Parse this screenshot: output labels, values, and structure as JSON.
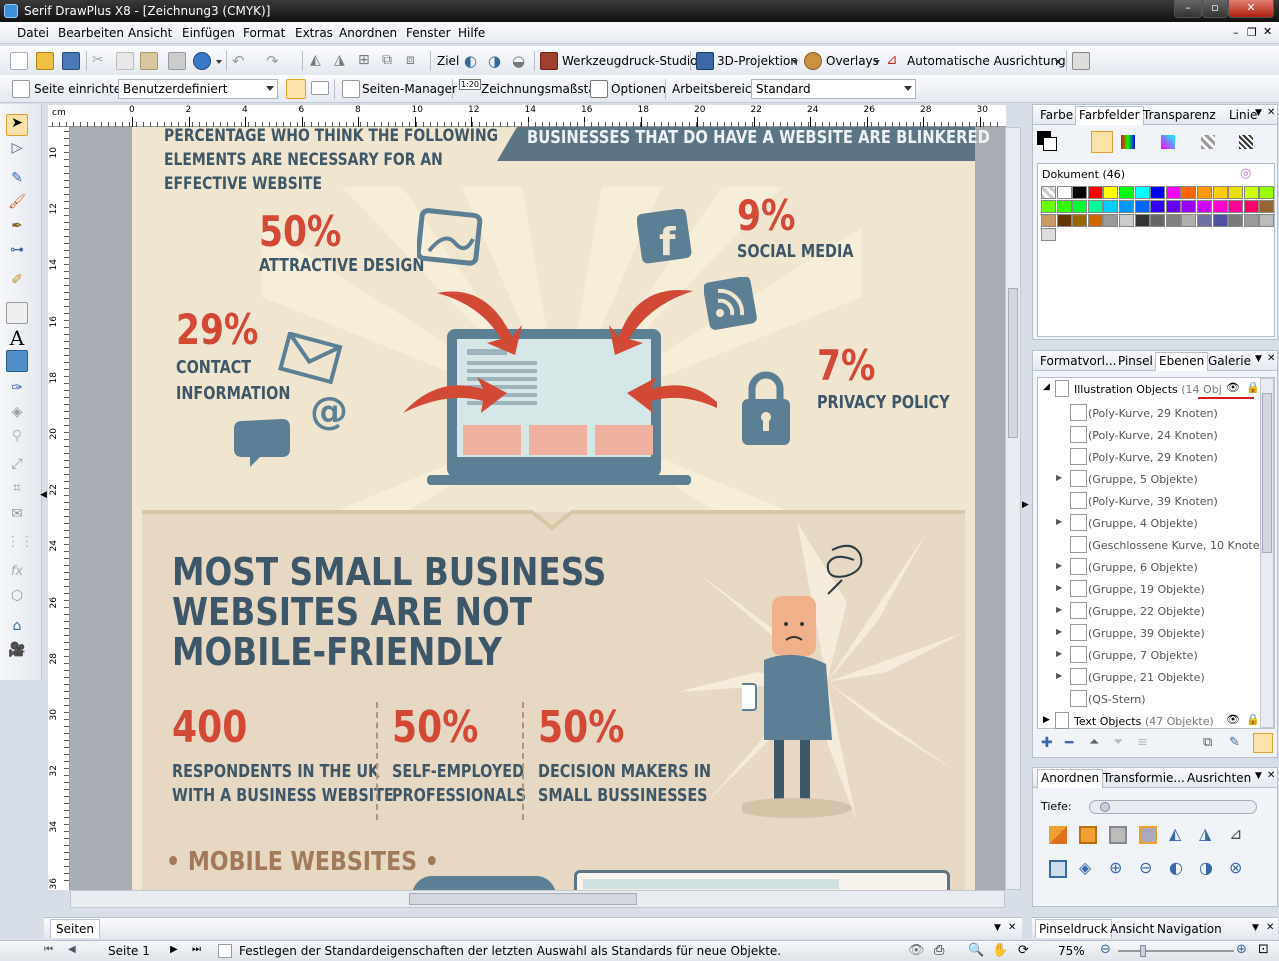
{
  "window": {
    "title": "Serif DrawPlus X8 - [Zeichnung3 (CMYK)]"
  },
  "menu": [
    "Datei",
    "Bearbeiten",
    "Ansicht",
    "Einfügen",
    "Format",
    "Extras",
    "Anordnen",
    "Fenster",
    "Hilfe"
  ],
  "toolbar1": {
    "target_label": "Ziel",
    "print_studio": "Werkzeugdruck-Studio",
    "projection": "3D-Projektion",
    "overlays": "Overlays",
    "auto_align": "Automatische Ausrichtung"
  },
  "toolbar2": {
    "page_setup": "Seite einrichten",
    "page_preset": "Benutzerdefiniert",
    "page_manager": "Seiten-Manager",
    "scale_badge": "1:20",
    "drawing_scale": "Zeichnungsmaßstab",
    "options": "Optionen",
    "workspace_label": "Arbeitsbereich",
    "workspace_value": "Standard"
  },
  "ruler": {
    "unit": "cm",
    "h_ticks": [
      "0",
      "2",
      "4",
      "6",
      "8",
      "10",
      "12",
      "14",
      "16",
      "18",
      "20",
      "22",
      "24",
      "26",
      "28",
      "30"
    ],
    "v_ticks": [
      "10",
      "12",
      "14",
      "16",
      "18",
      "20",
      "22",
      "24",
      "26",
      "28",
      "30",
      "32",
      "34",
      "36"
    ]
  },
  "infographic": {
    "heading_left": [
      "PERCENTAGE WHO THINK THE FOLLOWING",
      "ELEMENTS ARE NECESSARY FOR AN",
      "EFFECTIVE WEBSITE"
    ],
    "banner": "BUSINESSES THAT DO HAVE A WEBSITE ARE BLINKERED",
    "stats": [
      {
        "value": "50%",
        "label": [
          "ATTRACTIVE DESIGN"
        ]
      },
      {
        "value": "9%",
        "label": [
          "SOCIAL MEDIA"
        ]
      },
      {
        "value": "29%",
        "label": [
          "CONTACT",
          "INFORMATION"
        ]
      },
      {
        "value": "7%",
        "label": [
          "PRIVACY POLICY"
        ]
      }
    ],
    "mobile_heading": [
      "MOST SMALL BUSINESS",
      "WEBSITES ARE NOT",
      "MOBILE-FRIENDLY"
    ],
    "figures": [
      {
        "value": "400",
        "label": [
          "RESPONDENTS IN THE UK",
          "WITH A BUSINESS WEBSITE"
        ]
      },
      {
        "value": "50%",
        "label": [
          "SELF-EMPLOYED",
          "PROFESSIONALS"
        ]
      },
      {
        "value": "50%",
        "label": [
          "DECISION MAKERS IN",
          "SMALL BUSSINESSES"
        ]
      }
    ],
    "mobile_websites": "• MOBILE WEBSITES •",
    "colors": {
      "red": "#d24a34",
      "navy": "#3d5768",
      "bg_top": "#f0e6d0",
      "bg_bottom": "#e6d8c2",
      "slate": "#5c7f94"
    }
  },
  "color_panel": {
    "tabs": [
      "Farbe",
      "Farbfelder",
      "Transparenz",
      "Linie"
    ],
    "active": "Farbfelder",
    "palette_label": "Dokument (46)",
    "swatches": [
      "#ffffff",
      "#000000",
      "#ff0000",
      "#ffff00",
      "#00ff00",
      "#00ffff",
      "#0000ff",
      "#ff00ff",
      "#ff6600",
      "#ff9900",
      "#ffcc00",
      "#e8e000",
      "#ccff00",
      "#99ff00",
      "#66ff00",
      "#33ff00",
      "#00ff33",
      "#00ff99",
      "#00ccff",
      "#0099ff",
      "#0066ff",
      "#3300ff",
      "#6600ff",
      "#9900ff",
      "#cc00ff",
      "#ff00cc",
      "#ff0099",
      "#ff0066",
      "#996633",
      "#cc9966",
      "#663300",
      "#996600",
      "#cc6600",
      "#999999",
      "#cccccc",
      "#333333",
      "#666666",
      "#808080",
      "#b0b0b0",
      "#7070a0",
      "#5050a0",
      "#7a7a7a",
      "#9a9a9a",
      "#bbbbbb",
      "#dddddd"
    ]
  },
  "layers_panel": {
    "tabs": [
      "Formatvorl...",
      "Pinsel",
      "Ebenen",
      "Galerie"
    ],
    "active": "Ebenen",
    "layer1": "Illustration Objects",
    "layer1_count": "(14 Obj",
    "items": [
      "(Poly-Kurve, 29 Knoten)",
      "(Poly-Kurve, 24 Knoten)",
      "(Poly-Kurve, 29 Knoten)",
      "(Gruppe, 5 Objekte)",
      "(Poly-Kurve, 39 Knoten)",
      "(Gruppe, 4 Objekte)",
      "(Geschlossene Kurve, 10 Knoten)",
      "(Gruppe, 6 Objekte)",
      "(Gruppe, 19 Objekte)",
      "(Gruppe, 22 Objekte)",
      "(Gruppe, 39 Objekte)",
      "(Gruppe, 7 Objekte)",
      "(Gruppe, 21 Objekte)",
      "(QS-Stern)"
    ],
    "layer2": "Text Objects",
    "layer2_count": "(47 Objekte)"
  },
  "arrange_panel": {
    "tabs": [
      "Anordnen",
      "Transformie...",
      "Ausrichten"
    ],
    "active": "Anordnen",
    "depth_label": "Tiefe:"
  },
  "bottom_tabs": {
    "pages": "Seiten",
    "right": [
      "Pinseldruck",
      "Ansicht",
      "Navigation"
    ]
  },
  "status": {
    "page": "Seite 1",
    "message": "Festlegen der Standardeigenschaften der letzten Auswahl als Standards für neue Objekte.",
    "zoom": "75%"
  }
}
